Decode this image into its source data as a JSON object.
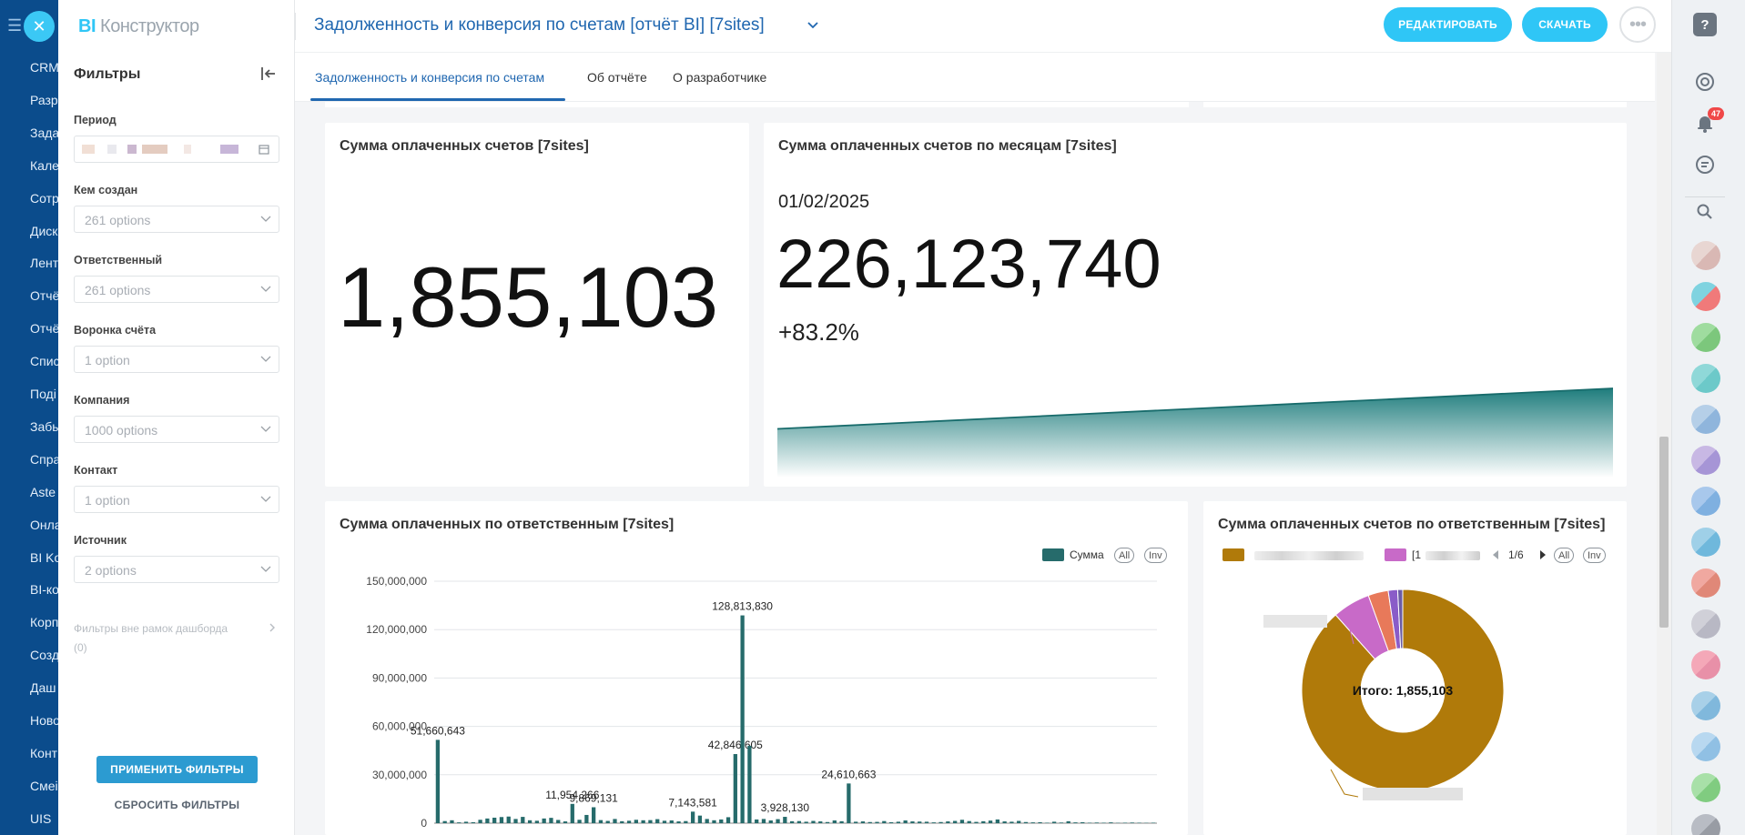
{
  "leftnav": {
    "items": [
      "CRM",
      "Разр",
      "Зада",
      "Кале",
      "Сотр",
      "Диск",
      "Лент",
      "Отчё",
      "Отчё",
      "Спис",
      "Поді",
      "Забы",
      "Спра",
      "Aste",
      "Онла",
      "BI Ko",
      "BI-ко",
      "Корп",
      "Созд",
      "Даш",
      "Ново",
      "Конт",
      "Смеі",
      "UIS"
    ]
  },
  "brand": {
    "part1": "BI",
    "part2": " Конструктор"
  },
  "filters": {
    "title": "Фильтры",
    "fields": [
      {
        "label": "Период",
        "value": ""
      },
      {
        "label": "Кем создан",
        "value": "261 options"
      },
      {
        "label": "Ответственный",
        "value": "261 options"
      },
      {
        "label": "Воронка счёта",
        "value": "1 option"
      },
      {
        "label": "Компания",
        "value": "1000 options"
      },
      {
        "label": "Контакт",
        "value": "1 option"
      },
      {
        "label": "Источник",
        "value": "2 options"
      }
    ],
    "outside_label": "Фильтры вне рамок дашборда",
    "outside_count": "(0)",
    "apply_label": "ПРИМЕНИТЬ ФИЛЬТРЫ",
    "reset_label": "СБРОСИТЬ ФИЛЬТРЫ"
  },
  "header": {
    "title": "Задолженность и конверсия по счетам [отчёт BI] [7sites]",
    "edit_label": "РЕДАКТИРОВАТЬ",
    "download_label": "СКАЧАТЬ",
    "more_label": "•••"
  },
  "tabs": [
    "Задолженность и конверсия по счетам",
    "Об отчёте",
    "О разработчике"
  ],
  "rightrail": {
    "help": "?",
    "notifications_count": "47"
  },
  "cards": {
    "total": {
      "title": "Сумма оплаченных счетов [7sites]",
      "value": "1,855,103"
    },
    "monthly": {
      "title": "Сумма оплаченных счетов по месяцам [7sites]",
      "date": "01/02/2025",
      "value": "226,123,740",
      "delta": "+83.2%"
    },
    "by_resp_bar": {
      "title": "Сумма оплаченных по ответственным [7sites]",
      "legend_label": "Сумма",
      "btn_all": "All",
      "btn_inv": "Inv"
    },
    "by_resp_pie": {
      "title": "Сумма оплаченных счетов по ответственным [7sites]",
      "legend_item2_prefix": "[1",
      "page_label": "1/6",
      "btn_all": "All",
      "btn_inv": "Inv",
      "center_label": "Итого: 1,855,103"
    }
  },
  "colors": {
    "accent": "#2fc6f6",
    "bar": "#266b6b",
    "pie_main": "#b07a0a",
    "pie_2": "#c86ac8",
    "pie_3": "#e8795a",
    "pie_4": "#8a5cc8"
  },
  "chart_data": [
    {
      "type": "area",
      "title": "Сумма оплаченных счетов по месяцам [7sites]",
      "note": "sparkline under big number",
      "x": [
        0,
        1
      ],
      "values": [
        123400000,
        226123740
      ]
    },
    {
      "type": "bar",
      "title": "Сумма оплаченных по ответственным [7sites]",
      "ylim": [
        0,
        150000000
      ],
      "yticks": [
        0,
        30000000,
        60000000,
        90000000,
        120000000,
        150000000
      ],
      "ytick_labels": [
        "0",
        "30,000,000",
        "60,000,000",
        "90,000,000",
        "120,000,000",
        "150,000,000"
      ],
      "series": [
        {
          "name": "Сумма",
          "values": [
            51660643,
            1300000,
            1800000,
            500000,
            900000,
            600000,
            2100000,
            2900000,
            3400000,
            3800000,
            4100000,
            2600000,
            3900000,
            1800000,
            1500000,
            2900000,
            3300000,
            2000000,
            1100000,
            11954266,
            2100000,
            5100000,
            9869131,
            1900000,
            1400000,
            2600000,
            1200000,
            1500000,
            2100000,
            1800000,
            1900000,
            2500000,
            1500000,
            1700000,
            1100000,
            1300000,
            7143581,
            4700000,
            2600000,
            1800000,
            2300000,
            3700000,
            42846605,
            128813830,
            48000000,
            2300000,
            2600000,
            1700000,
            2500000,
            3928130,
            1200000,
            1300000,
            900000,
            1400000,
            1100000,
            700000,
            1700000,
            1200000,
            24610663,
            900000,
            1100000,
            700000,
            800000,
            1300000,
            600000,
            900000,
            1700000,
            1100000,
            1000000,
            900000,
            500000,
            700000,
            1100000,
            1400000,
            2100000,
            1300000,
            800000,
            1200000,
            1600000,
            2300000,
            1100000,
            900000,
            1400000,
            700000,
            500000,
            600000,
            300000,
            900000,
            400000,
            1200000,
            500000,
            600000,
            300000,
            400000,
            300000,
            500000,
            200000,
            300000,
            400000,
            300000,
            200000,
            300000
          ]
        }
      ],
      "data_labels": [
        "51,660,643",
        "11,954,266",
        "9,869,131",
        "7,143,581",
        "42,846,605",
        "128,813,830",
        "3,928,130",
        "24,610,663"
      ]
    },
    {
      "type": "pie",
      "title": "Сумма оплаченных счетов по ответственным [7sites]",
      "center_label": "Итого: 1,855,103",
      "values": [
        88.0,
        6.0,
        3.2,
        1.5,
        0.8
      ]
    }
  ]
}
